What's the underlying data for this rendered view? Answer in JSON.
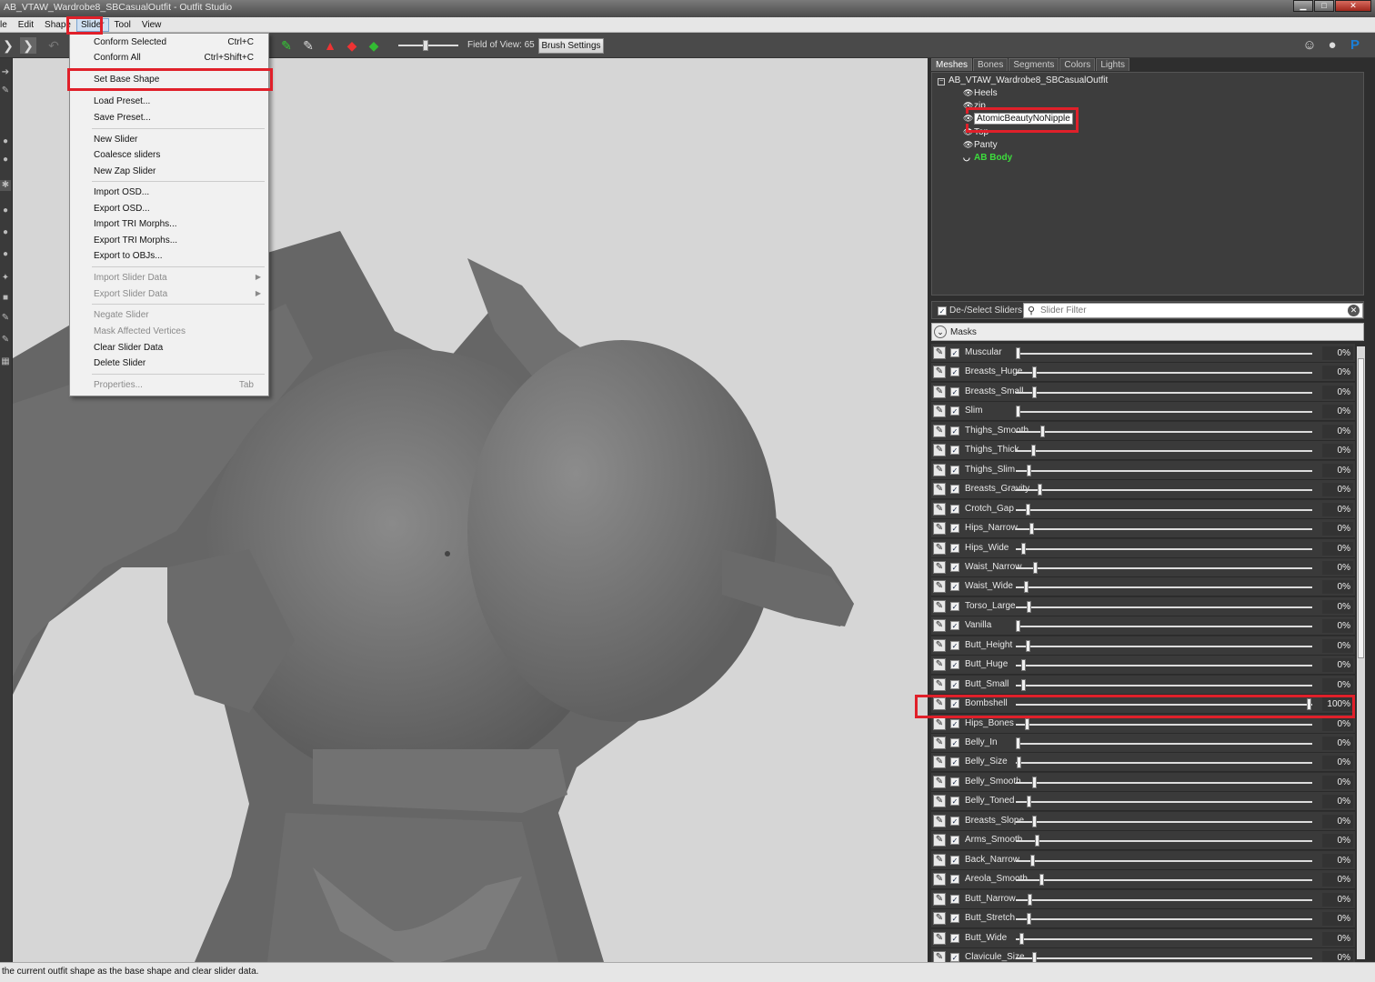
{
  "window": {
    "title": "AB_VTAW_Wardrobe8_SBCasualOutfit - Outfit Studio"
  },
  "menubar": [
    "le",
    "Edit",
    "Shape",
    "Slider",
    "Tool",
    "View"
  ],
  "toolbar": {
    "fov_label": "Field of View: 65",
    "fov_value": 65,
    "brush_settings": "Brush Settings"
  },
  "slider_menu": [
    {
      "label": "Conform Selected",
      "shortcut": "Ctrl+C",
      "enabled": true
    },
    {
      "label": "Conform All",
      "shortcut": "Ctrl+Shift+C",
      "enabled": true
    },
    {
      "label": "Set Base Shape",
      "shortcut": "",
      "enabled": true
    },
    {
      "label": "Load Preset...",
      "shortcut": "",
      "enabled": true
    },
    {
      "label": "Save Preset...",
      "shortcut": "",
      "enabled": true
    },
    {
      "label": "New Slider",
      "shortcut": "",
      "enabled": true
    },
    {
      "label": "Coalesce sliders",
      "shortcut": "",
      "enabled": true
    },
    {
      "label": "New Zap Slider",
      "shortcut": "",
      "enabled": true
    },
    {
      "label": "Import OSD...",
      "shortcut": "",
      "enabled": true
    },
    {
      "label": "Export OSD...",
      "shortcut": "",
      "enabled": true
    },
    {
      "label": "Import TRI Morphs...",
      "shortcut": "",
      "enabled": true
    },
    {
      "label": "Export TRI Morphs...",
      "shortcut": "",
      "enabled": true
    },
    {
      "label": "Export to OBJs...",
      "shortcut": "",
      "enabled": true
    },
    {
      "label": "Import Slider Data",
      "shortcut": "",
      "enabled": false
    },
    {
      "label": "Export Slider Data",
      "shortcut": "",
      "enabled": false
    },
    {
      "label": "Negate Slider",
      "shortcut": "",
      "enabled": false
    },
    {
      "label": "Mask Affected Vertices",
      "shortcut": "",
      "enabled": false
    },
    {
      "label": "Clear Slider Data",
      "shortcut": "",
      "enabled": true
    },
    {
      "label": "Delete Slider",
      "shortcut": "",
      "enabled": true
    },
    {
      "label": "Properties...",
      "shortcut": "Tab",
      "enabled": false
    }
  ],
  "panel_tabs": [
    "Meshes",
    "Bones",
    "Segments",
    "Colors",
    "Lights"
  ],
  "mesh_tree": {
    "root": "AB_VTAW_Wardrobe8_SBCasualOutfit",
    "items": [
      "Heels",
      "zip",
      "AtomicBeautyNoNipple",
      "Top",
      "Panty",
      "AB Body"
    ]
  },
  "slider_panel": {
    "deselect_label": "De-/Select Sliders",
    "filter_placeholder": "Slider Filter",
    "masks_label": "Masks"
  },
  "sliders": [
    {
      "name": "Muscular",
      "value": 0,
      "label": "0%"
    },
    {
      "name": "Breasts_Huge",
      "value": 0,
      "label": "0%"
    },
    {
      "name": "Breasts_Small",
      "value": 0,
      "label": "0%"
    },
    {
      "name": "Slim",
      "value": 0,
      "label": "0%"
    },
    {
      "name": "Thighs_Smooth",
      "value": 0,
      "label": "0%"
    },
    {
      "name": "Thighs_Thick",
      "value": 0,
      "label": "0%"
    },
    {
      "name": "Thighs_Slim",
      "value": 0,
      "label": "0%"
    },
    {
      "name": "Breasts_Gravity",
      "value": 0,
      "label": "0%"
    },
    {
      "name": "Crotch_Gap",
      "value": 0,
      "label": "0%"
    },
    {
      "name": "Hips_Narrow",
      "value": 0,
      "label": "0%"
    },
    {
      "name": "Hips_Wide",
      "value": 0,
      "label": "0%"
    },
    {
      "name": "Waist_Narrow",
      "value": 0,
      "label": "0%"
    },
    {
      "name": "Waist_Wide",
      "value": 0,
      "label": "0%"
    },
    {
      "name": "Torso_Large",
      "value": 0,
      "label": "0%"
    },
    {
      "name": "Vanilla",
      "value": 0,
      "label": "0%"
    },
    {
      "name": "Butt_Height",
      "value": 0,
      "label": "0%"
    },
    {
      "name": "Butt_Huge",
      "value": 0,
      "label": "0%"
    },
    {
      "name": "Butt_Small",
      "value": 0,
      "label": "0%"
    },
    {
      "name": "Bombshell",
      "value": 100,
      "label": "100%"
    },
    {
      "name": "Hips_Bones",
      "value": 0,
      "label": "0%"
    },
    {
      "name": "Belly_In",
      "value": 0,
      "label": "0%"
    },
    {
      "name": "Belly_Size",
      "value": 0,
      "label": "0%"
    },
    {
      "name": "Belly_Smooth",
      "value": 0,
      "label": "0%"
    },
    {
      "name": "Belly_Toned",
      "value": 0,
      "label": "0%"
    },
    {
      "name": "Breasts_Slope",
      "value": 0,
      "label": "0%"
    },
    {
      "name": "Arms_Smooth",
      "value": 0,
      "label": "0%"
    },
    {
      "name": "Back_Narrow",
      "value": 0,
      "label": "0%"
    },
    {
      "name": "Areola_Smooth",
      "value": 0,
      "label": "0%"
    },
    {
      "name": "Butt_Narrow",
      "value": 0,
      "label": "0%"
    },
    {
      "name": "Butt_Stretch",
      "value": 0,
      "label": "0%"
    },
    {
      "name": "Butt_Wide",
      "value": 0,
      "label": "0%"
    },
    {
      "name": "Clavicule_Size",
      "value": 0,
      "label": "0%"
    }
  ],
  "status": "the current outfit shape as the base shape and clear slider data.",
  "colors": {
    "highlight": "#e0202a",
    "active_mesh": "#3ddc3d"
  }
}
